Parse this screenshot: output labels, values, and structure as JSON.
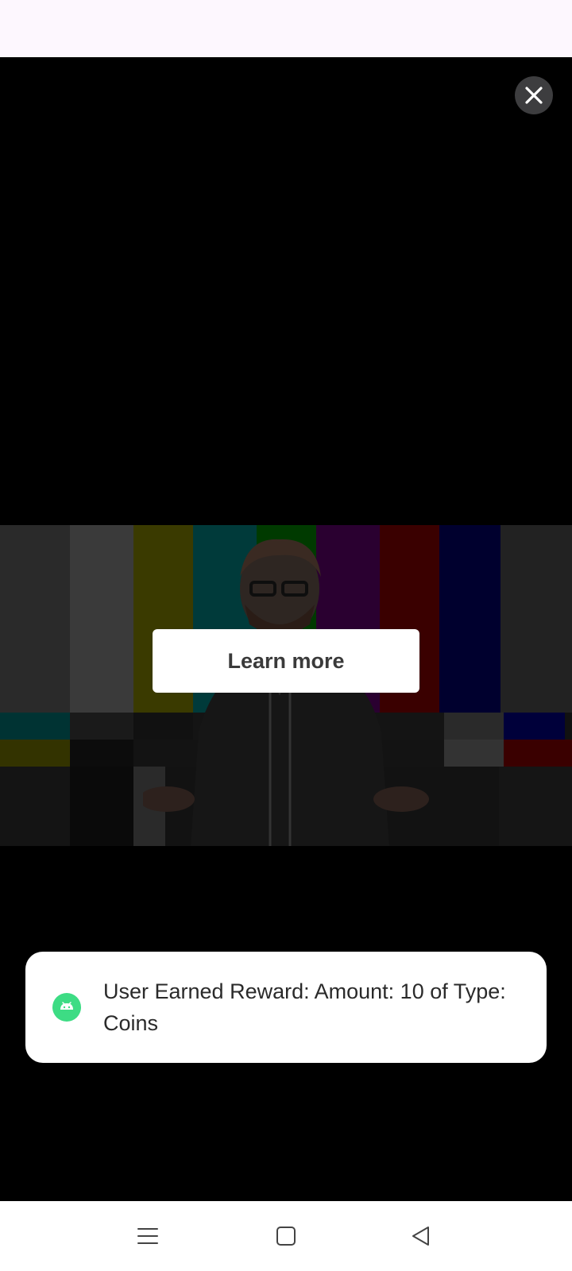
{
  "ad": {
    "close_icon": "close-icon",
    "learn_more_label": "Learn more"
  },
  "toast": {
    "icon": "android-icon",
    "icon_color": "#3ddc84",
    "message": "User Earned Reward: Amount: 10 of Type: Coins"
  },
  "navigation": {
    "menu_icon": "menu-icon",
    "home_icon": "home-icon",
    "back_icon": "back-icon"
  },
  "colors": {
    "status_bar": "#fdf7fe",
    "ad_background": "#000000",
    "close_button": "#3d3d3f",
    "nav_bar": "#ffffff"
  }
}
